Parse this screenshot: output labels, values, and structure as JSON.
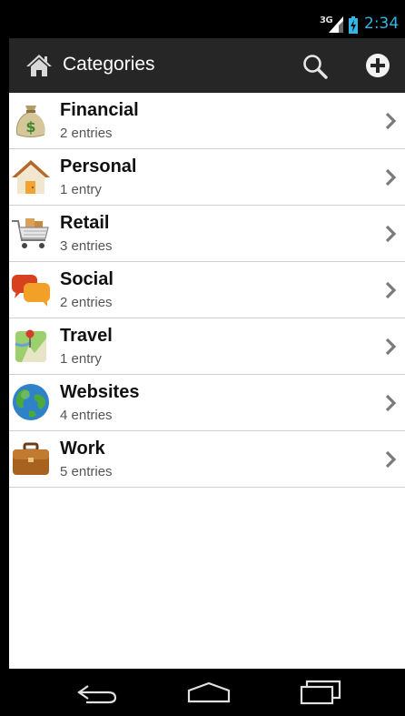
{
  "status_bar": {
    "network": "3G",
    "time": "2:34",
    "time_color": "#33b5e5"
  },
  "action_bar": {
    "title": "Categories",
    "background": "#262626",
    "icons": [
      "home-icon",
      "search-icon",
      "add-icon"
    ]
  },
  "categories": [
    {
      "name": "Financial",
      "entries": "2 entries",
      "icon": "money-bag-icon"
    },
    {
      "name": "Personal",
      "entries": "1 entry",
      "icon": "house-icon"
    },
    {
      "name": "Retail",
      "entries": "3 entries",
      "icon": "shopping-cart-icon"
    },
    {
      "name": "Social",
      "entries": "2 entries",
      "icon": "speech-bubbles-icon"
    },
    {
      "name": "Travel",
      "entries": "1 entry",
      "icon": "map-pin-icon"
    },
    {
      "name": "Websites",
      "entries": "4 entries",
      "icon": "globe-icon"
    },
    {
      "name": "Work",
      "entries": "5 entries",
      "icon": "briefcase-icon"
    }
  ],
  "nav_bar": {
    "icons": [
      "back-icon",
      "home-icon",
      "recent-apps-icon"
    ]
  }
}
